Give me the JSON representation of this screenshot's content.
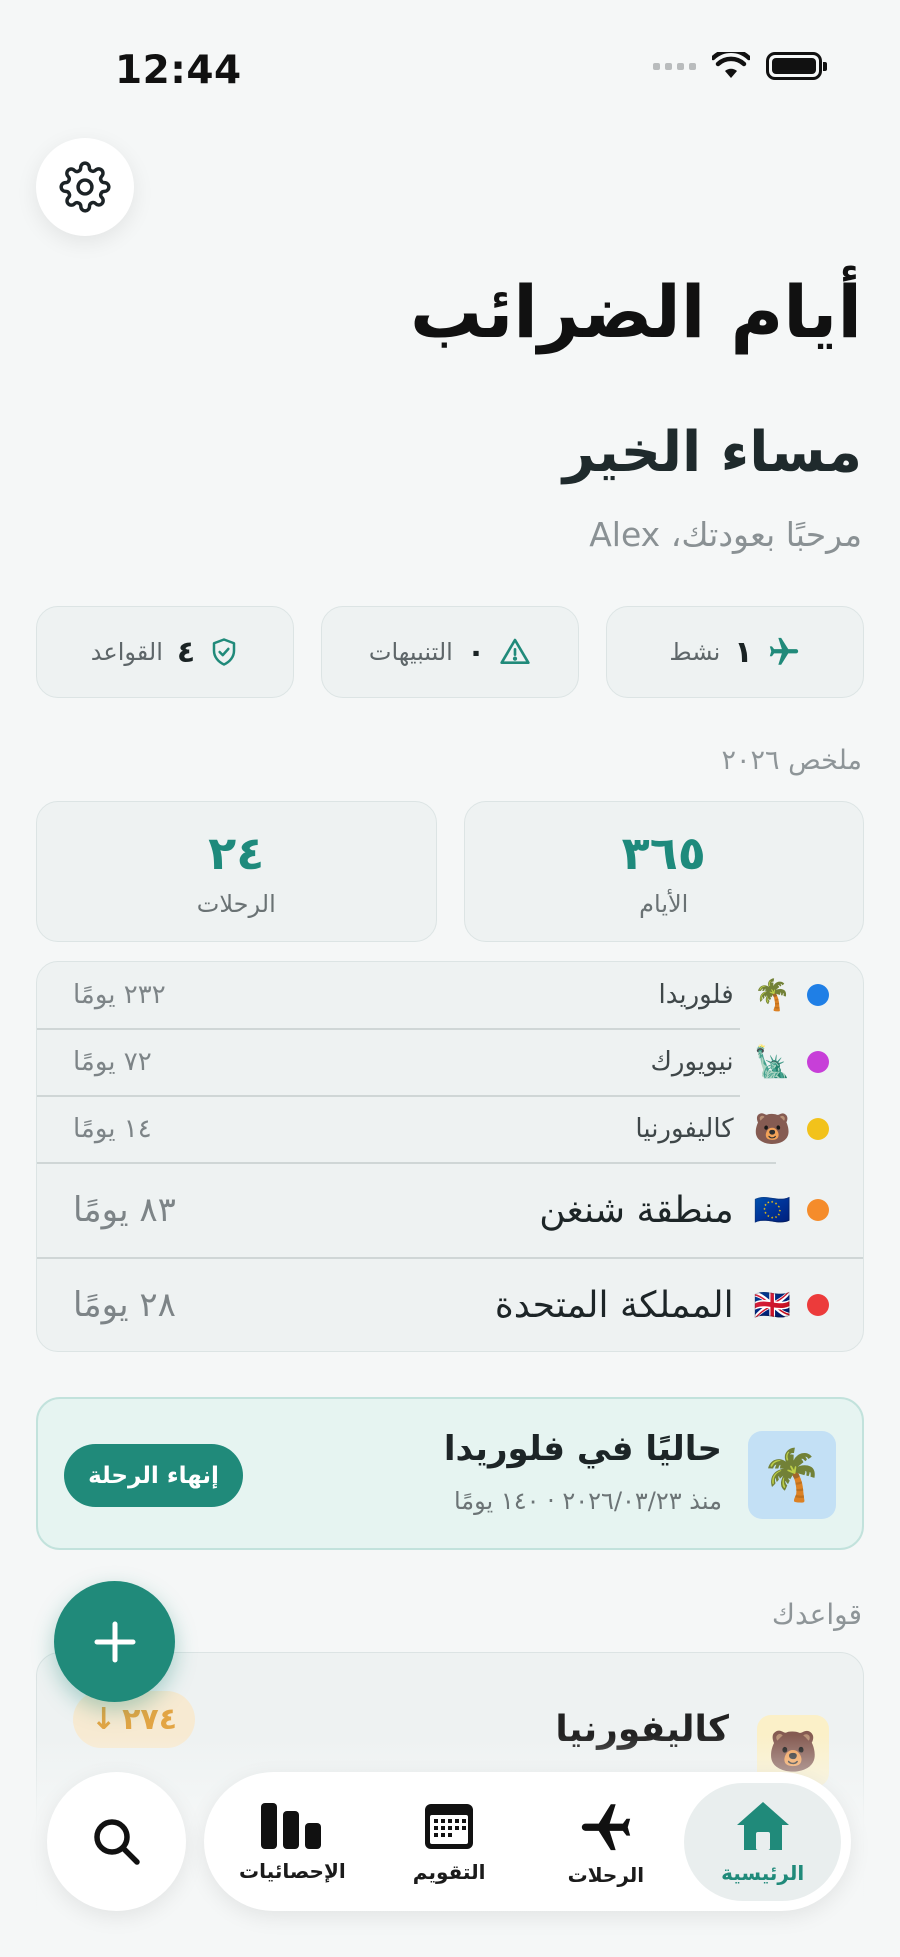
{
  "status_bar": {
    "time": "12:44"
  },
  "header": {
    "title": "أيام الضرائب",
    "greeting": "مساء الخير",
    "welcome": "مرحبًا بعودتك، Alex"
  },
  "chips": [
    {
      "icon": "plane-icon",
      "value": "١",
      "label": "نشط"
    },
    {
      "icon": "warning-icon",
      "value": "٠",
      "label": "التنبيهات"
    },
    {
      "icon": "shield-check-icon",
      "value": "٤",
      "label": "القواعد"
    }
  ],
  "summary": {
    "label": "ملخص ٢٠٢٦",
    "stats": [
      {
        "value": "٣٦٥",
        "label": "الأيام"
      },
      {
        "value": "٢٤",
        "label": "الرحلات"
      }
    ]
  },
  "destinations": [
    {
      "color": "#1f7fe6",
      "flag": "🌴",
      "name": "فلوريدا",
      "days": "٢٣٢ يومًا"
    },
    {
      "color": "#c73fd8",
      "flag": "🗽",
      "name": "نيويورك",
      "days": "٧٢ يومًا"
    },
    {
      "color": "#f2c21b",
      "flag": "🐻",
      "name": "كاليفورنيا",
      "days": "١٤ يومًا"
    },
    {
      "color": "#f58c2b",
      "flag": "🇪🇺",
      "name": "منطقة شنغن",
      "days": "٨٣ يومًا"
    },
    {
      "color": "#ec3b3b",
      "flag": "🇬🇧",
      "name": "المملكة المتحدة",
      "days": "٢٨ يومًا"
    }
  ],
  "current_trip": {
    "emoji": "🌴",
    "title": "حاليًا في فلوريدا",
    "subtitle": "منذ ٢٠٢٦/٠٣/٢٣ · ١٤٠ يومًا",
    "end_button": "إنهاء الرحلة"
  },
  "rules": {
    "label": "قواعدك",
    "first": {
      "emoji": "🐻",
      "title": "كاليفورنيا",
      "badge": "٢٧٤"
    }
  },
  "tabs": [
    {
      "label": "الرئيسية",
      "icon": "home-icon",
      "active": true
    },
    {
      "label": "الرحلات",
      "icon": "plane-icon",
      "active": false
    },
    {
      "label": "التقويم",
      "icon": "calendar-icon",
      "active": false
    },
    {
      "label": "الإحصائيات",
      "icon": "bar-chart-icon",
      "active": false
    }
  ],
  "colors": {
    "accent": "#208a7a",
    "warning": "#e3a544"
  }
}
